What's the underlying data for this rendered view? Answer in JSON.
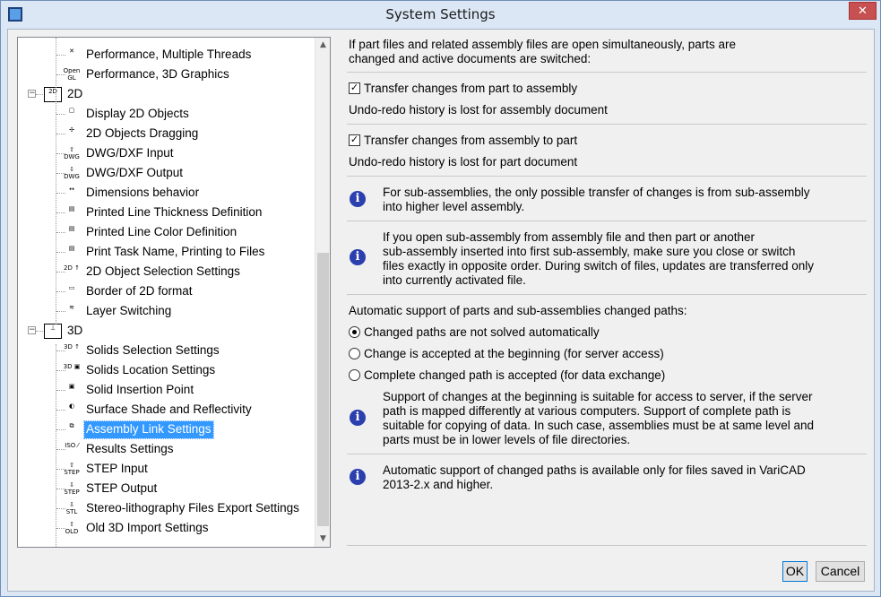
{
  "window": {
    "title": "System Settings",
    "close_glyph": "✕"
  },
  "tree": {
    "items": [
      {
        "label": "Performance, Multiple Threads",
        "icon": "threads-icon",
        "glyph": "✕"
      },
      {
        "label": "Performance, 3D Graphics",
        "icon": "opengl-icon",
        "glyph": "Open GL"
      },
      {
        "label": "2D",
        "icon": "2d-icon",
        "glyph": "2D",
        "folder": true,
        "expander": "−"
      },
      {
        "label": "Display 2D Objects",
        "icon": "display-icon",
        "glyph": "▢"
      },
      {
        "label": "2D Objects Dragging",
        "icon": "drag-icon",
        "glyph": "✢"
      },
      {
        "label": "DWG/DXF Input",
        "icon": "dwg-input-icon",
        "glyph": "⇧ DWG"
      },
      {
        "label": "DWG/DXF Output",
        "icon": "dwg-output-icon",
        "glyph": "⇩ DWG"
      },
      {
        "label": "Dimensions behavior",
        "icon": "dimension-icon",
        "glyph": "↔"
      },
      {
        "label": "Printed Line Thickness Definition",
        "icon": "printer-icon",
        "glyph": "▤"
      },
      {
        "label": "Printed Line Color Definition",
        "icon": "printer-color-icon",
        "glyph": "▤"
      },
      {
        "label": "Print Task Name, Printing to Files",
        "icon": "printer-file-icon",
        "glyph": "▤"
      },
      {
        "label": "2D Object Selection Settings",
        "icon": "2d-selection-icon",
        "glyph": "2D ↑"
      },
      {
        "label": "Border of 2D format",
        "icon": "border-icon",
        "glyph": "▭"
      },
      {
        "label": "Layer Switching",
        "icon": "layer-icon",
        "glyph": "≋"
      },
      {
        "label": "3D",
        "icon": "3d-icon",
        "glyph": "⊥",
        "folder": true,
        "expander": "−"
      },
      {
        "label": "Solids Selection Settings",
        "icon": "3d-selection-icon",
        "glyph": "3D ↑"
      },
      {
        "label": "Solids Location Settings",
        "icon": "3d-location-icon",
        "glyph": "3D ▣"
      },
      {
        "label": "Solid Insertion Point",
        "icon": "insertion-point-icon",
        "glyph": "▣"
      },
      {
        "label": "Surface Shade and Reflectivity",
        "icon": "shade-icon",
        "glyph": "◐"
      },
      {
        "label": "Assembly Link Settings",
        "icon": "assembly-link-icon",
        "glyph": "⧉",
        "selected": true
      },
      {
        "label": "Results Settings",
        "icon": "results-icon",
        "glyph": "ISO ⁄"
      },
      {
        "label": "STEP Input",
        "icon": "step-input-icon",
        "glyph": "⇧ STEP"
      },
      {
        "label": "STEP Output",
        "icon": "step-output-icon",
        "glyph": "⇩ STEP"
      },
      {
        "label": "Stereo-lithography Files Export Settings",
        "icon": "stl-icon",
        "glyph": "⇩ STL"
      },
      {
        "label": "Old 3D Import Settings",
        "icon": "old-import-icon",
        "glyph": "⇧ OLD"
      }
    ],
    "scroll_up": "▲",
    "scroll_down": "▼"
  },
  "panel": {
    "intro_line1": "If part files and related assembly files are open simultaneously, parts are",
    "intro_line2": "changed and active documents are switched:",
    "check1_mark": "✓",
    "check1_label": "Transfer changes from part to assembly",
    "check1_note": "Undo-redo history is lost for assembly document",
    "check2_mark": "✓",
    "check2_label": "Transfer changes from assembly to part",
    "check2_note": "Undo-redo history is lost for part document",
    "info_glyph": "i",
    "info1_line1": "For sub-assemblies, the only possible transfer of changes is from sub-assembly",
    "info1_line2": "into higher level assembly.",
    "info2_line1": "If you open sub-assembly from assembly file and then part or another",
    "info2_line2": "sub-assembly inserted into first sub-assembly, make sure you close or switch",
    "info2_line3": "files exactly in opposite order. During switch of files, updates are transferred only",
    "info2_line4": "into currently activated file.",
    "auto_heading": "Automatic support of parts and sub-assemblies changed paths:",
    "radio1_label": "Changed paths are not solved automatically",
    "radio2_label": "Change is accepted at the beginning (for server access)",
    "radio3_label": "Complete changed path is accepted (for data exchange)",
    "info3_line1": "Support of changes at the beginning is suitable for access to server, if the server",
    "info3_line2": "path is mapped differently at various computers. Support of complete path is",
    "info3_line3": "suitable for copying of data. In such case, assemblies must be at same level and",
    "info3_line4": "parts must be in lower levels of file directories.",
    "info4_line1": "Automatic support of changed paths is available only for files saved in VariCAD",
    "info4_line2": "2013-2.x and higher."
  },
  "buttons": {
    "ok": "OK",
    "cancel": "Cancel"
  }
}
